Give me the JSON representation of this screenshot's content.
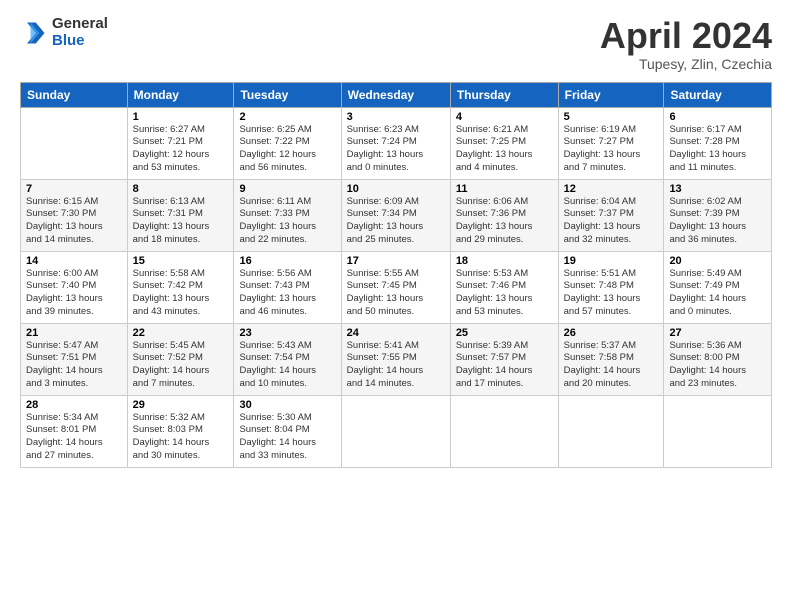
{
  "header": {
    "logo_general": "General",
    "logo_blue": "Blue",
    "title": "April 2024",
    "subtitle": "Tupesy, Zlin, Czechia"
  },
  "weekdays": [
    "Sunday",
    "Monday",
    "Tuesday",
    "Wednesday",
    "Thursday",
    "Friday",
    "Saturday"
  ],
  "weeks": [
    [
      {
        "day": "",
        "info": ""
      },
      {
        "day": "1",
        "info": "Sunrise: 6:27 AM\nSunset: 7:21 PM\nDaylight: 12 hours\nand 53 minutes."
      },
      {
        "day": "2",
        "info": "Sunrise: 6:25 AM\nSunset: 7:22 PM\nDaylight: 12 hours\nand 56 minutes."
      },
      {
        "day": "3",
        "info": "Sunrise: 6:23 AM\nSunset: 7:24 PM\nDaylight: 13 hours\nand 0 minutes."
      },
      {
        "day": "4",
        "info": "Sunrise: 6:21 AM\nSunset: 7:25 PM\nDaylight: 13 hours\nand 4 minutes."
      },
      {
        "day": "5",
        "info": "Sunrise: 6:19 AM\nSunset: 7:27 PM\nDaylight: 13 hours\nand 7 minutes."
      },
      {
        "day": "6",
        "info": "Sunrise: 6:17 AM\nSunset: 7:28 PM\nDaylight: 13 hours\nand 11 minutes."
      }
    ],
    [
      {
        "day": "7",
        "info": "Sunrise: 6:15 AM\nSunset: 7:30 PM\nDaylight: 13 hours\nand 14 minutes."
      },
      {
        "day": "8",
        "info": "Sunrise: 6:13 AM\nSunset: 7:31 PM\nDaylight: 13 hours\nand 18 minutes."
      },
      {
        "day": "9",
        "info": "Sunrise: 6:11 AM\nSunset: 7:33 PM\nDaylight: 13 hours\nand 22 minutes."
      },
      {
        "day": "10",
        "info": "Sunrise: 6:09 AM\nSunset: 7:34 PM\nDaylight: 13 hours\nand 25 minutes."
      },
      {
        "day": "11",
        "info": "Sunrise: 6:06 AM\nSunset: 7:36 PM\nDaylight: 13 hours\nand 29 minutes."
      },
      {
        "day": "12",
        "info": "Sunrise: 6:04 AM\nSunset: 7:37 PM\nDaylight: 13 hours\nand 32 minutes."
      },
      {
        "day": "13",
        "info": "Sunrise: 6:02 AM\nSunset: 7:39 PM\nDaylight: 13 hours\nand 36 minutes."
      }
    ],
    [
      {
        "day": "14",
        "info": "Sunrise: 6:00 AM\nSunset: 7:40 PM\nDaylight: 13 hours\nand 39 minutes."
      },
      {
        "day": "15",
        "info": "Sunrise: 5:58 AM\nSunset: 7:42 PM\nDaylight: 13 hours\nand 43 minutes."
      },
      {
        "day": "16",
        "info": "Sunrise: 5:56 AM\nSunset: 7:43 PM\nDaylight: 13 hours\nand 46 minutes."
      },
      {
        "day": "17",
        "info": "Sunrise: 5:55 AM\nSunset: 7:45 PM\nDaylight: 13 hours\nand 50 minutes."
      },
      {
        "day": "18",
        "info": "Sunrise: 5:53 AM\nSunset: 7:46 PM\nDaylight: 13 hours\nand 53 minutes."
      },
      {
        "day": "19",
        "info": "Sunrise: 5:51 AM\nSunset: 7:48 PM\nDaylight: 13 hours\nand 57 minutes."
      },
      {
        "day": "20",
        "info": "Sunrise: 5:49 AM\nSunset: 7:49 PM\nDaylight: 14 hours\nand 0 minutes."
      }
    ],
    [
      {
        "day": "21",
        "info": "Sunrise: 5:47 AM\nSunset: 7:51 PM\nDaylight: 14 hours\nand 3 minutes."
      },
      {
        "day": "22",
        "info": "Sunrise: 5:45 AM\nSunset: 7:52 PM\nDaylight: 14 hours\nand 7 minutes."
      },
      {
        "day": "23",
        "info": "Sunrise: 5:43 AM\nSunset: 7:54 PM\nDaylight: 14 hours\nand 10 minutes."
      },
      {
        "day": "24",
        "info": "Sunrise: 5:41 AM\nSunset: 7:55 PM\nDaylight: 14 hours\nand 14 minutes."
      },
      {
        "day": "25",
        "info": "Sunrise: 5:39 AM\nSunset: 7:57 PM\nDaylight: 14 hours\nand 17 minutes."
      },
      {
        "day": "26",
        "info": "Sunrise: 5:37 AM\nSunset: 7:58 PM\nDaylight: 14 hours\nand 20 minutes."
      },
      {
        "day": "27",
        "info": "Sunrise: 5:36 AM\nSunset: 8:00 PM\nDaylight: 14 hours\nand 23 minutes."
      }
    ],
    [
      {
        "day": "28",
        "info": "Sunrise: 5:34 AM\nSunset: 8:01 PM\nDaylight: 14 hours\nand 27 minutes."
      },
      {
        "day": "29",
        "info": "Sunrise: 5:32 AM\nSunset: 8:03 PM\nDaylight: 14 hours\nand 30 minutes."
      },
      {
        "day": "30",
        "info": "Sunrise: 5:30 AM\nSunset: 8:04 PM\nDaylight: 14 hours\nand 33 minutes."
      },
      {
        "day": "",
        "info": ""
      },
      {
        "day": "",
        "info": ""
      },
      {
        "day": "",
        "info": ""
      },
      {
        "day": "",
        "info": ""
      }
    ]
  ]
}
